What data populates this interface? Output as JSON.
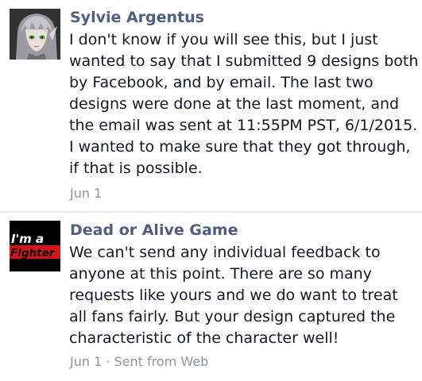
{
  "messages": [
    {
      "sender": "Sylvie Argentus",
      "avatar_icon": "anime-character-avatar",
      "body": "I don't know if you will see this, but I just wanted to say that I submitted 9 designs both by Facebook, and by email. The last two designs were done at the last moment, and the email was sent at 11:55PM PST, 6/1/2015. I wanted to make sure that they got through, if that is possible.",
      "meta": "Jun 1"
    },
    {
      "sender": "Dead or Alive Game",
      "avatar_icon": "im-a-fighter-logo",
      "avatar_text_line1": "I'm a",
      "avatar_text_line2": "Fighter",
      "body": "We can't send any individual feedback to anyone at this point. There are so many requests like yours and we do want to treat all fans fairly. But your design captured the characteristic of the character well!",
      "meta": "Jun 1 · Sent from Web"
    }
  ],
  "colors": {
    "sender": "#4e5f87",
    "body": "#141823",
    "meta": "#90949c",
    "divider": "#e9eaed",
    "fighter_red": "#d8141a"
  }
}
